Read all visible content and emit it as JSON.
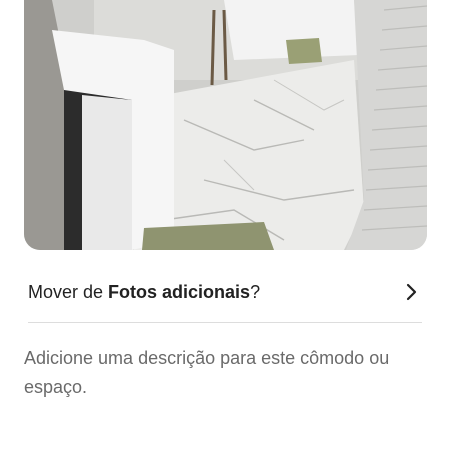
{
  "photo": {
    "alt": "room-photo",
    "colors": {
      "wall": "#cfcfcc",
      "floor": "#e8e8e6",
      "cabinet": "#f4f4f4",
      "shutter": "#d9d9d9",
      "mat": "#8f9470"
    }
  },
  "move_row": {
    "prefix": "Mover de ",
    "album": "Fotos adicionais",
    "suffix": "?"
  },
  "description_placeholder": "Adicione uma descrição para este cômodo ou espaço."
}
